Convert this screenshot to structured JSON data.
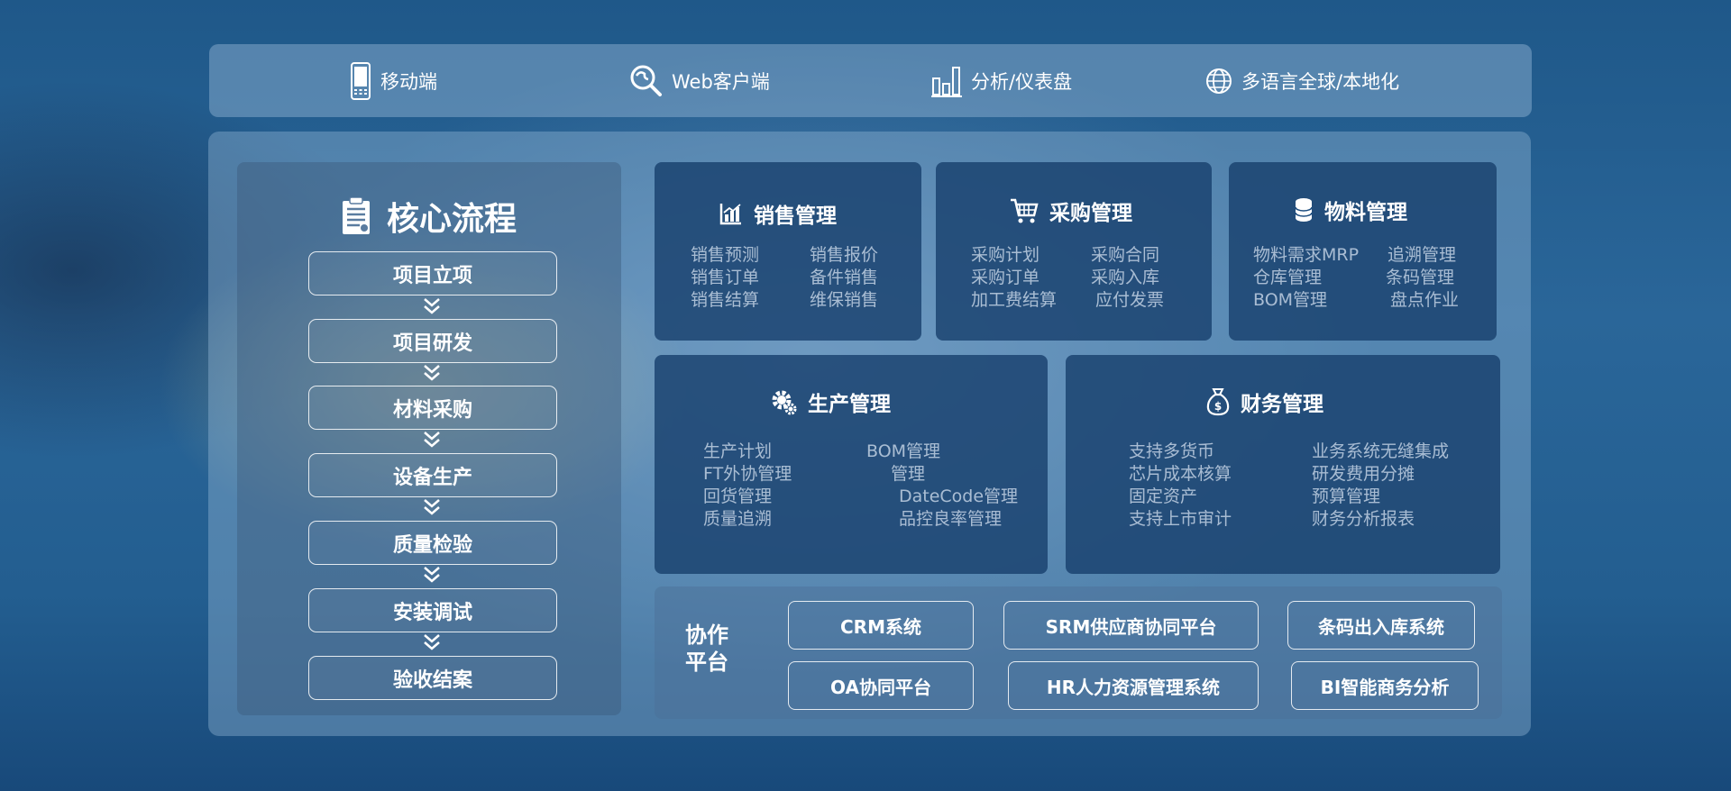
{
  "top_bar": {
    "items": [
      {
        "label": "移动端",
        "icon": "mobile-phone-icon"
      },
      {
        "label": "Web客户端",
        "icon": "web-client-icon"
      },
      {
        "label": "分析/仪表盘",
        "icon": "bar-chart-icon"
      },
      {
        "label": "多语言全球/本地化",
        "icon": "globe-icon"
      }
    ]
  },
  "core": {
    "title": "核心流程",
    "icon": "clipboard-icon",
    "steps": [
      "项目立项",
      "项目研发",
      "材料采购",
      "设备生产",
      "质量检验",
      "安装调试",
      "验收结案"
    ]
  },
  "modules": {
    "sales": {
      "title": "销售管理",
      "icon": "chart-icon",
      "col1": [
        "销售预测",
        "销售订单",
        "销售结算"
      ],
      "col2": [
        "销售报价",
        "备件销售",
        "维保销售"
      ]
    },
    "purchase": {
      "title": "采购管理",
      "icon": "cart-icon",
      "col1": [
        "采购计划",
        "采购订单",
        "加工费结算"
      ],
      "col2": [
        "采购合同",
        "采购入库",
        "应付发票"
      ]
    },
    "material": {
      "title": "物料管理",
      "icon": "database-icon",
      "col1": [
        "物料需求MRP",
        "仓库管理",
        "BOM管理"
      ],
      "col2": [
        "追溯管理",
        "条码管理",
        "盘点作业"
      ]
    },
    "production": {
      "title": "生产管理",
      "icon": "gear-icon",
      "col1": [
        "生产计划",
        "FT外协管理",
        "回货管理",
        "质量追溯"
      ],
      "col2": [
        "BOM管理",
        "管理",
        "DateCode管理",
        "品控良率管理"
      ]
    },
    "finance": {
      "title": "财务管理",
      "icon": "money-bag-icon",
      "col1": [
        "支持多货币",
        "芯片成本核算",
        "固定资产",
        "支持上市审计"
      ],
      "col2": [
        "业务系统无缝集成",
        "研发费用分摊",
        "预算管理",
        "财务分析报表"
      ]
    }
  },
  "collab": {
    "label": "协作平台",
    "row1": [
      "CRM系统",
      "SRM供应商协同平台",
      "条码出入库系统"
    ],
    "row2": [
      "OA协同平台",
      "HR人力资源管理系统",
      "BI智能商务分析"
    ]
  }
}
